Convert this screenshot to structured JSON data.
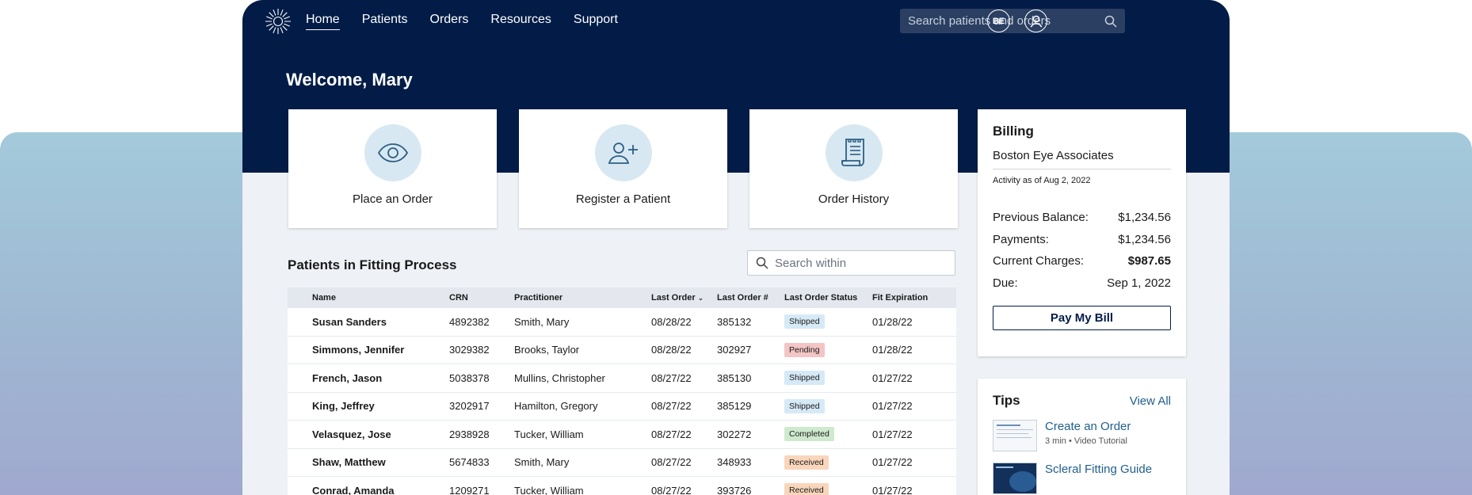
{
  "nav": {
    "items": [
      {
        "label": "Home",
        "active": true
      },
      {
        "label": "Patients",
        "active": false
      },
      {
        "label": "Orders",
        "active": false
      },
      {
        "label": "Resources",
        "active": false
      },
      {
        "label": "Support",
        "active": false
      }
    ],
    "search_placeholder": "Search patients and orders",
    "org_initials": "BE"
  },
  "welcome": "Welcome, Mary",
  "actions": [
    {
      "label": "Place an Order",
      "icon": "eye-icon"
    },
    {
      "label": "Register a Patient",
      "icon": "add-person-icon"
    },
    {
      "label": "Order History",
      "icon": "receipt-icon"
    }
  ],
  "billing": {
    "title": "Billing",
    "org": "Boston Eye Associates",
    "as_of": "Activity as of Aug 2, 2022",
    "rows": [
      {
        "label": "Previous Balance:",
        "value": "$1,234.56"
      },
      {
        "label": "Payments:",
        "value": "$1,234.56"
      },
      {
        "label": "Current Charges:",
        "value": "$987.65"
      },
      {
        "label": "Due:",
        "value": "Sep 1, 2022"
      }
    ],
    "pay_label": "Pay My Bill"
  },
  "tips": {
    "title": "Tips",
    "view_all": "View All",
    "items": [
      {
        "title": "Create an Order",
        "meta": "3 min • Video Tutorial"
      },
      {
        "title": "Scleral Fitting Guide",
        "meta": ""
      }
    ]
  },
  "patients": {
    "title": "Patients in Fitting Process",
    "search_placeholder": "Search within",
    "columns": [
      "Name",
      "CRN",
      "Practitioner",
      "Last Order",
      "Last Order #",
      "Last Order Status",
      "Fit Expiration"
    ],
    "rows": [
      [
        "Susan Sanders",
        "4892382",
        "Smith, Mary",
        "08/28/22",
        "385132",
        "Shipped",
        "01/28/22"
      ],
      [
        "Simmons, Jennifer",
        "3029382",
        "Brooks, Taylor",
        "08/28/22",
        "302927",
        "Pending",
        "01/28/22"
      ],
      [
        "French, Jason",
        "5038378",
        "Mullins, Christopher",
        "08/27/22",
        "385130",
        "Shipped",
        "01/27/22"
      ],
      [
        "King, Jeffrey",
        "3202917",
        "Hamilton, Gregory",
        "08/27/22",
        "385129",
        "Shipped",
        "01/27/22"
      ],
      [
        "Velasquez, Jose",
        "2938928",
        "Tucker, William",
        "08/27/22",
        "302272",
        "Completed",
        "01/27/22"
      ],
      [
        "Shaw, Matthew",
        "5674833",
        "Smith, Mary",
        "08/27/22",
        "348933",
        "Received",
        "01/27/22"
      ],
      [
        "Conrad, Amanda",
        "1209271",
        "Tucker, William",
        "08/27/22",
        "393726",
        "Received",
        "01/27/22"
      ]
    ]
  },
  "colors": {
    "navy": "#021c47",
    "link": "#1f5f8b",
    "shipped": "#d6e9f6",
    "pending": "#f3c5c5",
    "completed": "#cfe9cf",
    "received": "#f9d6bb"
  }
}
